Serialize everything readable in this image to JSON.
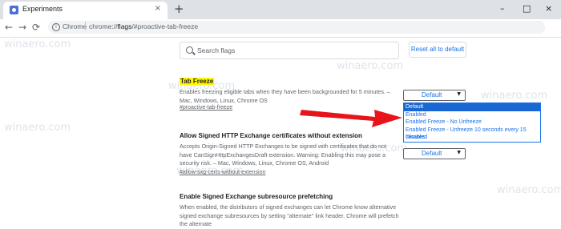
{
  "browser": {
    "tab_title": "Experiments",
    "tab_close": "×",
    "new_tab": "+",
    "window_controls": [
      "–",
      "□",
      "×"
    ],
    "nav": {
      "back": "←",
      "forward": "→",
      "reload": "⟳"
    },
    "omnibox": {
      "site_label": "Chrome",
      "url_prefix": "chrome://",
      "url_flags": "flags",
      "url_suffix": "/#proactive-tab-freeze"
    }
  },
  "page": {
    "search_placeholder": "Search flags",
    "reset_label": "Reset all to default",
    "experiments": [
      {
        "title": "Tab Freeze",
        "description": "Enables freezing eligible tabs when they have been backgrounded for 5 minutes. – Mac, Windows, Linux, Chrome OS",
        "link": "#proactive-tab-freeze",
        "select_value": "Default"
      },
      {
        "title": "Allow Signed HTTP Exchange certificates without extension",
        "description": "Accepts Origin-Signed HTTP Exchanges to be signed with certificates that do not have CanSignHttpExchangesDraft extension. Warning: Enabling this may pose a security risk. – Mac, Windows, Linux, Chrome OS, Android",
        "link": "#allow-sxg-certs-without-extension",
        "select_value": "Default"
      },
      {
        "title": "Enable Signed Exchange subresource prefetching",
        "description": "When enabled, the distributors of signed exchanges can let Chrome know alternative signed exchange subresources by setting \"alternate\" link header. Chrome will prefetch the alternate"
      }
    ],
    "dropdown_options": [
      "Default",
      "Enabled",
      "Enabled Freeze - No Unfreeze",
      "Enabled Freeze - Unfreeze 10 seconds every 15 minutes",
      "Disabled"
    ],
    "dropdown_selected_index": 0
  },
  "colors": {
    "accent": "#1a73e8",
    "highlight": "#fff700",
    "arrow": "#e8141b",
    "selected_option": "#1967d2"
  },
  "watermark": "winaero.com"
}
